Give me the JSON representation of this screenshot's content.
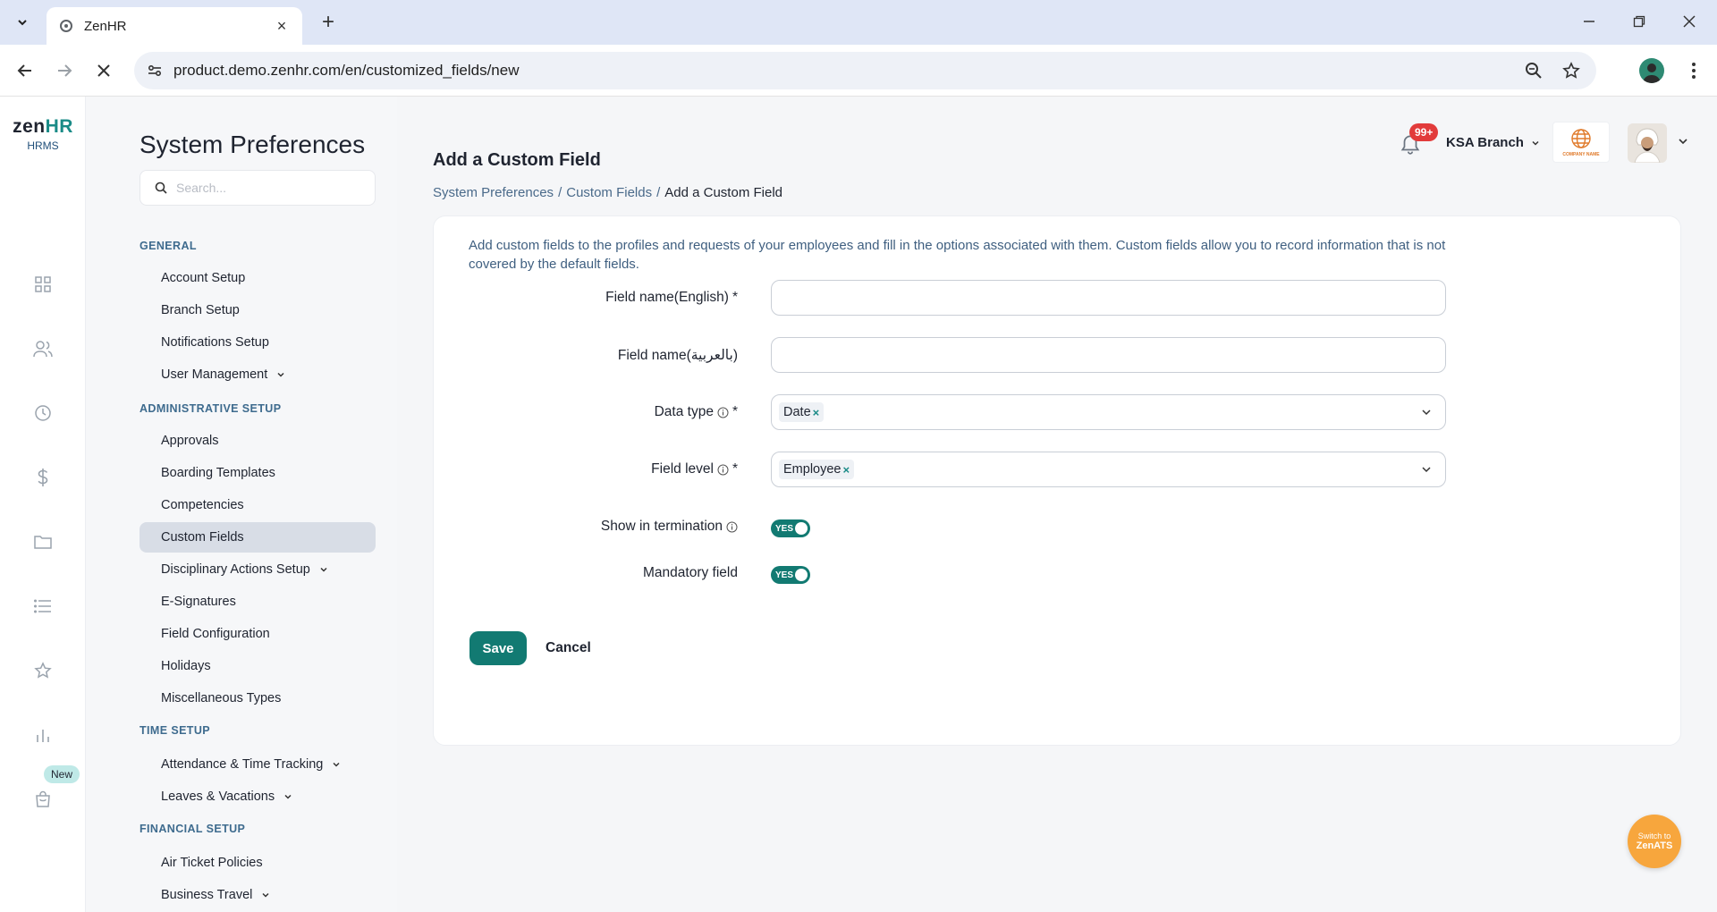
{
  "browser": {
    "tab_title": "ZenHR",
    "url": "product.demo.zenhr.com/en/customized_fields/new"
  },
  "rail": {
    "logo_text_a": "zen",
    "logo_text_b": "HR",
    "logo_sub": "HRMS",
    "new_badge": "New",
    "icons": [
      "dashboard-icon",
      "people-icon",
      "clock-icon",
      "dollar-icon",
      "folder-icon",
      "list-icon",
      "star-icon",
      "chart-icon",
      "bag-icon"
    ]
  },
  "sidebar": {
    "title": "System Preferences",
    "search_placeholder": "Search...",
    "sections": {
      "general": "GENERAL",
      "admin": "ADMINISTRATIVE SETUP",
      "time": "TIME SETUP",
      "financial": "FINANCIAL SETUP"
    },
    "items": {
      "account_setup": "Account Setup",
      "branch_setup": "Branch Setup",
      "notifications_setup": "Notifications Setup",
      "user_management": "User Management",
      "approvals": "Approvals",
      "boarding_templates": "Boarding Templates",
      "competencies": "Competencies",
      "custom_fields": "Custom Fields",
      "disciplinary_actions": "Disciplinary Actions Setup",
      "e_signatures": "E-Signatures",
      "field_configuration": "Field Configuration",
      "holidays": "Holidays",
      "misc_types": "Miscellaneous Types",
      "attendance": "Attendance & Time Tracking",
      "leaves": "Leaves & Vacations",
      "air_ticket": "Air Ticket Policies",
      "business_travel": "Business Travel"
    }
  },
  "header": {
    "notification_count": "99+",
    "branch": "KSA Branch",
    "company_logo_text": "COMPANY NAME"
  },
  "page": {
    "title": "Add a Custom Field",
    "breadcrumb": [
      "System Preferences",
      "/",
      "Custom Fields",
      "/",
      "Add a Custom Field"
    ],
    "intro": "Add custom fields to the profiles and requests of your employees and fill in the options associated with them. Custom fields allow you to record information that is not covered by the default fields."
  },
  "form": {
    "field_name_en_label": "Field name(English)",
    "field_name_ar_label": "Field name(بالعربية)",
    "data_type_label": "Data type",
    "data_type_value": "Date",
    "field_level_label": "Field level",
    "field_level_value": "Employee",
    "show_termination_label": "Show in termination",
    "mandatory_label": "Mandatory field",
    "toggle_yes": "YES",
    "required_mark": "*",
    "chip_remove": "×",
    "save": "Save",
    "cancel": "Cancel"
  },
  "zenats": {
    "line1": "Switch to",
    "line2": "ZenATS"
  },
  "colors": {
    "accent": "#127a72",
    "badge": "#e23b3b",
    "zenats": "#f7a63d"
  }
}
